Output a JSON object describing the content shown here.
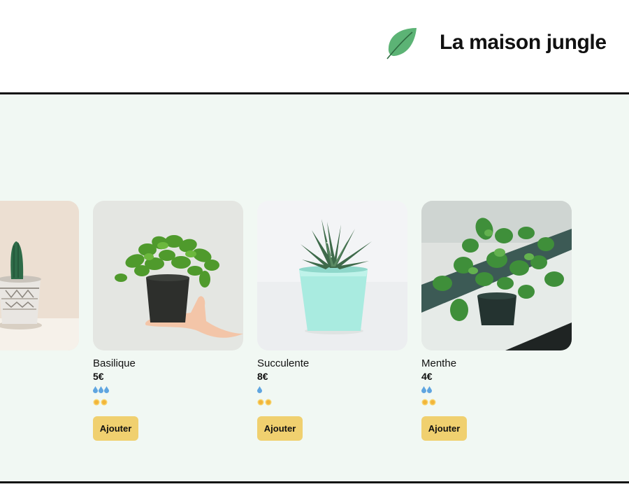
{
  "header": {
    "title": "La maison jungle",
    "logo_icon": "leaf-icon",
    "logo_color": "#5cb375"
  },
  "colors": {
    "background": "#f1f8f3",
    "button": "#f0d06f",
    "divider": "#111111"
  },
  "plants": [
    {
      "name": "Cactus (partially visible)",
      "price": "",
      "water": 0,
      "light": 0,
      "image_icon": "cactus-image"
    },
    {
      "name": "Basilique",
      "price": "5€",
      "water": 3,
      "light": 2,
      "image_icon": "basil-image"
    },
    {
      "name": "Succulente",
      "price": "8€",
      "water": 1,
      "light": 2,
      "image_icon": "succulent-image"
    },
    {
      "name": "Menthe",
      "price": "4€",
      "water": 2,
      "light": 2,
      "image_icon": "mint-image"
    }
  ],
  "add_button_label": "Ajouter",
  "icons": {
    "water": "water-drop-icon",
    "light": "sun-icon"
  }
}
